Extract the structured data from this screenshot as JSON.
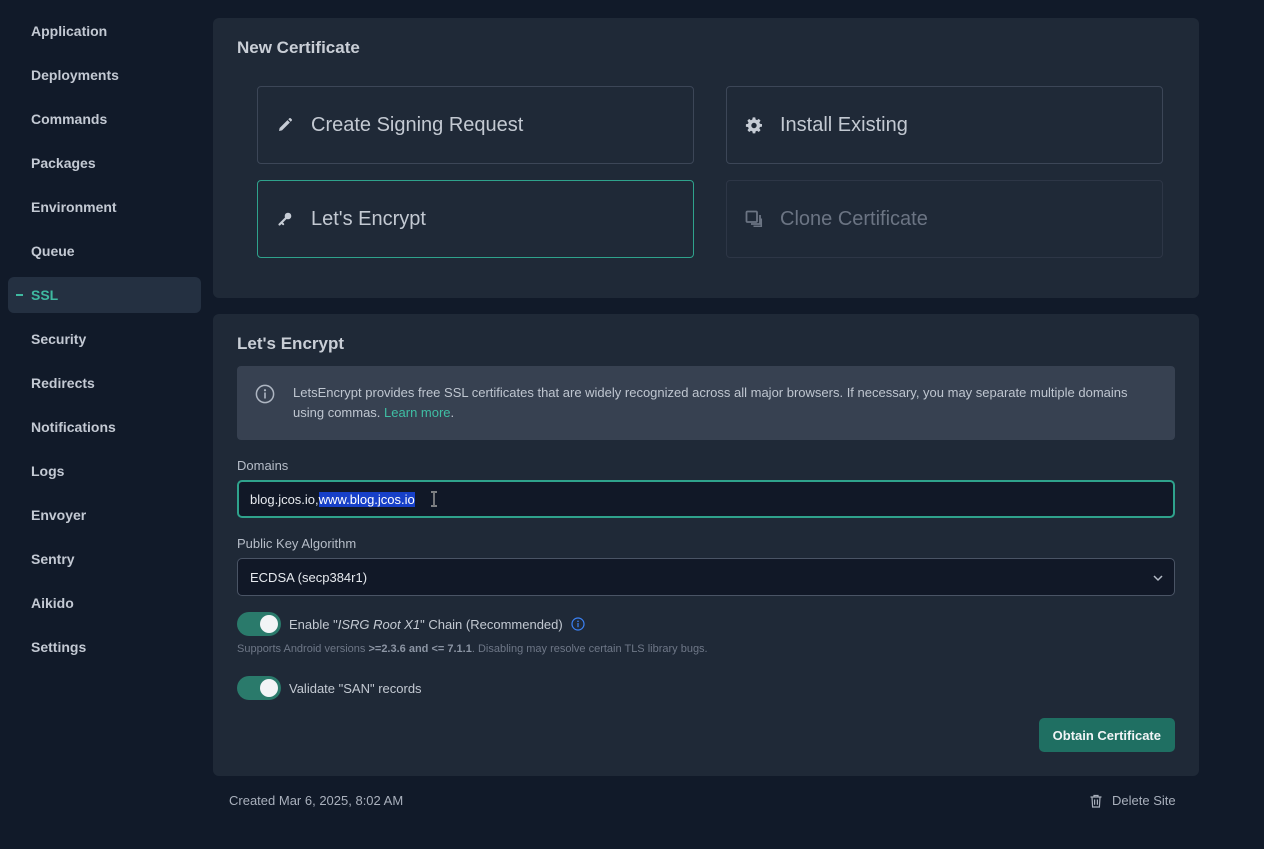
{
  "sidebar": {
    "items": [
      {
        "label": "Application"
      },
      {
        "label": "Deployments"
      },
      {
        "label": "Commands"
      },
      {
        "label": "Packages"
      },
      {
        "label": "Environment"
      },
      {
        "label": "Queue"
      },
      {
        "label": "SSL",
        "active": true
      },
      {
        "label": "Security"
      },
      {
        "label": "Redirects"
      },
      {
        "label": "Notifications"
      },
      {
        "label": "Logs"
      },
      {
        "label": "Envoyer"
      },
      {
        "label": "Sentry"
      },
      {
        "label": "Aikido"
      },
      {
        "label": "Settings"
      }
    ]
  },
  "new_certificate": {
    "title": "New Certificate",
    "options": {
      "create_signing_request": {
        "label": "Create Signing Request",
        "icon": "pencil-icon"
      },
      "install_existing": {
        "label": "Install Existing",
        "icon": "gear-icon"
      },
      "lets_encrypt": {
        "label": "Let's Encrypt",
        "icon": "key-icon",
        "selected": true
      },
      "clone_certificate": {
        "label": "Clone Certificate",
        "icon": "copy-icon",
        "disabled": true
      }
    }
  },
  "lets_encrypt": {
    "title": "Let's Encrypt",
    "info_text": "LetsEncrypt provides free SSL certificates that are widely recognized across all major browsers. If necessary, you may separate multiple domains using commas.",
    "info_link": "Learn more",
    "info_suffix": ".",
    "domains_label": "Domains",
    "domains_value_plain": "blog.jcos.io,",
    "domains_value_selected": "www.blog.jcos.io",
    "algorithm_label": "Public Key Algorithm",
    "algorithm_value": "ECDSA (secp384r1)",
    "chain_toggle": {
      "prefix": "Enable \"",
      "emphasis": "ISRG Root X1",
      "suffix": "\" Chain (Recommended)",
      "enabled": true
    },
    "chain_hint": {
      "prefix": "Supports Android versions ",
      "bold": ">=2.3.6 and <= 7.1.1",
      "suffix": ". Disabling may resolve certain TLS library bugs."
    },
    "san_toggle": {
      "label": "Validate \"SAN\" records",
      "enabled": true
    },
    "obtain_button": "Obtain Certificate"
  },
  "footer": {
    "created": "Created Mar 6, 2025, 8:02 AM",
    "delete_site": "Delete Site"
  },
  "colors": {
    "accent": "#3fb9a0",
    "button": "#1f6f62",
    "background": "#111a29",
    "panel": "#1f2937"
  }
}
